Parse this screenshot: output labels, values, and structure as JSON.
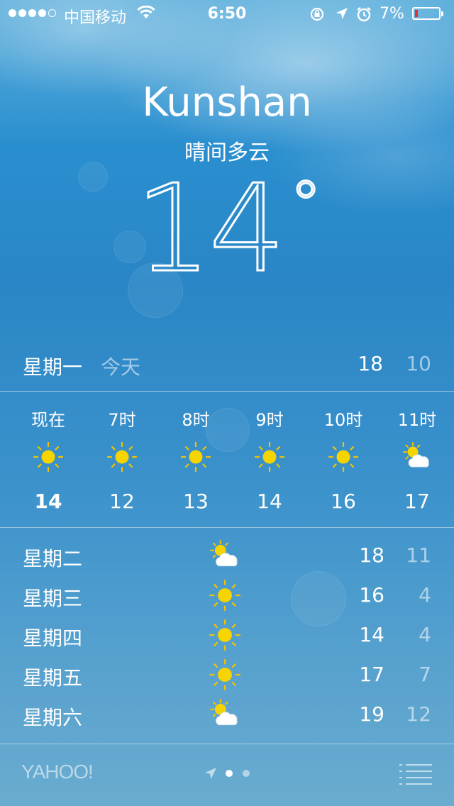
{
  "status_bar": {
    "carrier": "中国移动",
    "time": "6:50",
    "battery_percent": "7%",
    "battery_color": "#e4312b",
    "signal_bars_filled": 4,
    "signal_bars_total": 5
  },
  "header": {
    "city": "Kunshan",
    "condition": "晴间多云",
    "temperature": "14",
    "degree_symbol": "°"
  },
  "today": {
    "day": "星期一",
    "label": "今天",
    "high": "18",
    "low": "10"
  },
  "hourly": [
    {
      "label": "现在",
      "icon": "sun-icon",
      "temp": "14",
      "bold": true
    },
    {
      "label": "7时",
      "icon": "sun-icon",
      "temp": "12"
    },
    {
      "label": "8时",
      "icon": "sun-icon",
      "temp": "13"
    },
    {
      "label": "9时",
      "icon": "sun-icon",
      "temp": "14"
    },
    {
      "label": "10时",
      "icon": "sun-icon",
      "temp": "16"
    },
    {
      "label": "11时",
      "icon": "partly-cloudy-icon",
      "temp": "17"
    }
  ],
  "daily": [
    {
      "day": "星期二",
      "icon": "partly-cloudy-icon",
      "high": "18",
      "low": "11"
    },
    {
      "day": "星期三",
      "icon": "sun-icon",
      "high": "16",
      "low": "4"
    },
    {
      "day": "星期四",
      "icon": "sun-icon",
      "high": "14",
      "low": "4"
    },
    {
      "day": "星期五",
      "icon": "sun-icon",
      "high": "17",
      "low": "7"
    },
    {
      "day": "星期六",
      "icon": "partly-cloudy-icon",
      "high": "19",
      "low": "12"
    }
  ],
  "footer": {
    "brand": "YAHOO!",
    "current_page": 1,
    "page_count": 2
  },
  "colors": {
    "sun": "#f5d400",
    "sun_rays": "#f2c200"
  }
}
